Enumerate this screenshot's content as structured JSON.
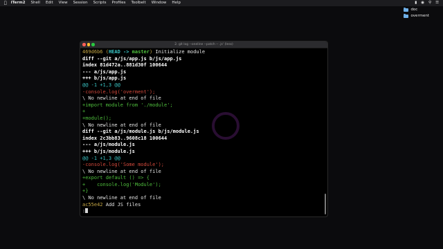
{
  "menubar": {
    "apple_icon": "apple-icon",
    "items": [
      "iTerm2",
      "Shell",
      "Edit",
      "View",
      "Session",
      "Scripts",
      "Profiles",
      "Toolbelt",
      "Window",
      "Help"
    ],
    "status_icons": [
      "battery-icon",
      "wifi-icon",
      "search-icon",
      "control-center-icon"
    ]
  },
  "desktop": {
    "items": [
      {
        "label": "doc",
        "icon": "folder-icon"
      },
      {
        "label": "overment",
        "icon": "folder-icon"
      }
    ]
  },
  "window": {
    "title": "2. git log --oneline --patch -- .js' (less)"
  },
  "terminal": {
    "lines": [
      {
        "type": "commit",
        "hash": "469d6b6",
        "open": " (",
        "head": "HEAD -> ",
        "branch": "master",
        "close": ")",
        "msg": " Initialize module"
      },
      {
        "type": "bold",
        "text": "diff --git a/js/app.js b/js/app.js"
      },
      {
        "type": "bold",
        "text": "index 81d472a..881d30f 100644"
      },
      {
        "type": "bold",
        "text": "--- a/js/app.js"
      },
      {
        "type": "bold",
        "text": "+++ b/js/app.js"
      },
      {
        "type": "meta",
        "text": "@@ -1 +1,3 @@"
      },
      {
        "type": "del",
        "text": "-console.log('overment');"
      },
      {
        "type": "plain",
        "text": "\\ No newline at end of file"
      },
      {
        "type": "add",
        "text": "+import module from './module';"
      },
      {
        "type": "add",
        "text": "+"
      },
      {
        "type": "add",
        "text": "+module();"
      },
      {
        "type": "plain",
        "text": "\\ No newline at end of file"
      },
      {
        "type": "bold",
        "text": "diff --git a/js/module.js b/js/module.js"
      },
      {
        "type": "bold",
        "text": "index 2c3bb83..9608c18 100644"
      },
      {
        "type": "bold",
        "text": "--- a/js/module.js"
      },
      {
        "type": "bold",
        "text": "+++ b/js/module.js"
      },
      {
        "type": "meta",
        "text": "@@ -1 +1,3 @@"
      },
      {
        "type": "del",
        "text": "-console.log('Some module');"
      },
      {
        "type": "plain",
        "text": "\\ No newline at end of file"
      },
      {
        "type": "add",
        "text": "+export default () => {"
      },
      {
        "type": "add",
        "text": "+    console.log('Module');"
      },
      {
        "type": "add",
        "text": "+}"
      },
      {
        "type": "plain",
        "text": "\\ No newline at end of file"
      },
      {
        "type": "commit2",
        "hash": "ac55e42",
        "msg": " Add JS files"
      }
    ],
    "prompt": ":"
  },
  "colors": {
    "hash": "#c7a845",
    "meta": "#3ac6c6",
    "deleted": "#d54a3c",
    "added": "#4fbf3d"
  }
}
